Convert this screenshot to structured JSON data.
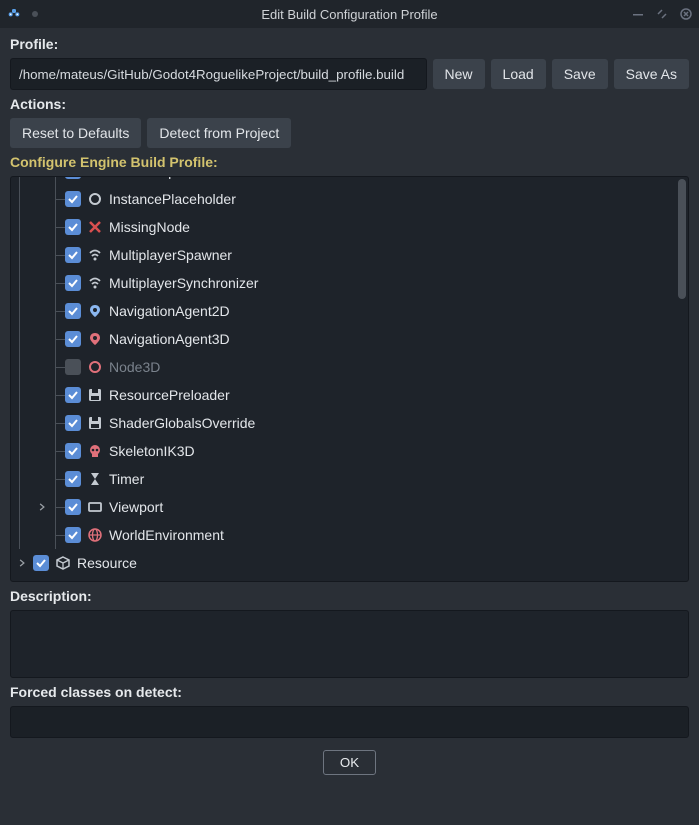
{
  "window": {
    "title": "Edit Build Configuration Profile"
  },
  "profile": {
    "label": "Profile:",
    "path": "/home/mateus/GitHub/Godot4RoguelikeProject/build_profile.build",
    "buttons": {
      "new": "New",
      "load": "Load",
      "save": "Save",
      "save_as": "Save As"
    }
  },
  "actions": {
    "label": "Actions:",
    "reset": "Reset to Defaults",
    "detect": "Detect from Project"
  },
  "configure": {
    "label": "Configure Engine Build Profile:"
  },
  "tree": {
    "items": [
      {
        "label": "HTTPRequest",
        "checked": true,
        "icon": "http",
        "iconColor": "#8bb7f0",
        "indent": 1,
        "expander": false,
        "cut": true
      },
      {
        "label": "InstancePlaceholder",
        "checked": true,
        "icon": "circle",
        "iconColor": "#c4cad1",
        "indent": 1,
        "expander": false
      },
      {
        "label": "MissingNode",
        "checked": true,
        "icon": "x",
        "iconColor": "#d94f4f",
        "indent": 1,
        "expander": false
      },
      {
        "label": "MultiplayerSpawner",
        "checked": true,
        "icon": "wifi",
        "iconColor": "#c4cad1",
        "indent": 1,
        "expander": false
      },
      {
        "label": "MultiplayerSynchronizer",
        "checked": true,
        "icon": "wifi",
        "iconColor": "#c4cad1",
        "indent": 1,
        "expander": false
      },
      {
        "label": "NavigationAgent2D",
        "checked": true,
        "icon": "pin",
        "iconColor": "#8bb7f0",
        "indent": 1,
        "expander": false
      },
      {
        "label": "NavigationAgent3D",
        "checked": true,
        "icon": "pin",
        "iconColor": "#e0707a",
        "indent": 1,
        "expander": false
      },
      {
        "label": "Node3D",
        "checked": false,
        "icon": "circle",
        "iconColor": "#e0707a",
        "indent": 1,
        "expander": false,
        "dim": true
      },
      {
        "label": "ResourcePreloader",
        "checked": true,
        "icon": "save",
        "iconColor": "#c4cad1",
        "indent": 1,
        "expander": false
      },
      {
        "label": "ShaderGlobalsOverride",
        "checked": true,
        "icon": "save",
        "iconColor": "#c4cad1",
        "indent": 1,
        "expander": false
      },
      {
        "label": "SkeletonIK3D",
        "checked": true,
        "icon": "skull",
        "iconColor": "#e0707a",
        "indent": 1,
        "expander": false
      },
      {
        "label": "Timer",
        "checked": true,
        "icon": "hourglass",
        "iconColor": "#c4cad1",
        "indent": 1,
        "expander": false
      },
      {
        "label": "Viewport",
        "checked": true,
        "icon": "rect",
        "iconColor": "#c4cad1",
        "indent": 1,
        "expander": true
      },
      {
        "label": "WorldEnvironment",
        "checked": true,
        "icon": "globe",
        "iconColor": "#e0707a",
        "indent": 1,
        "expander": false
      },
      {
        "label": "Resource",
        "checked": true,
        "icon": "cube",
        "iconColor": "#c4cad1",
        "indent": 0,
        "expander": true
      }
    ]
  },
  "description": {
    "label": "Description:"
  },
  "forced": {
    "label": "Forced classes on detect:"
  },
  "ok": {
    "label": "OK"
  }
}
